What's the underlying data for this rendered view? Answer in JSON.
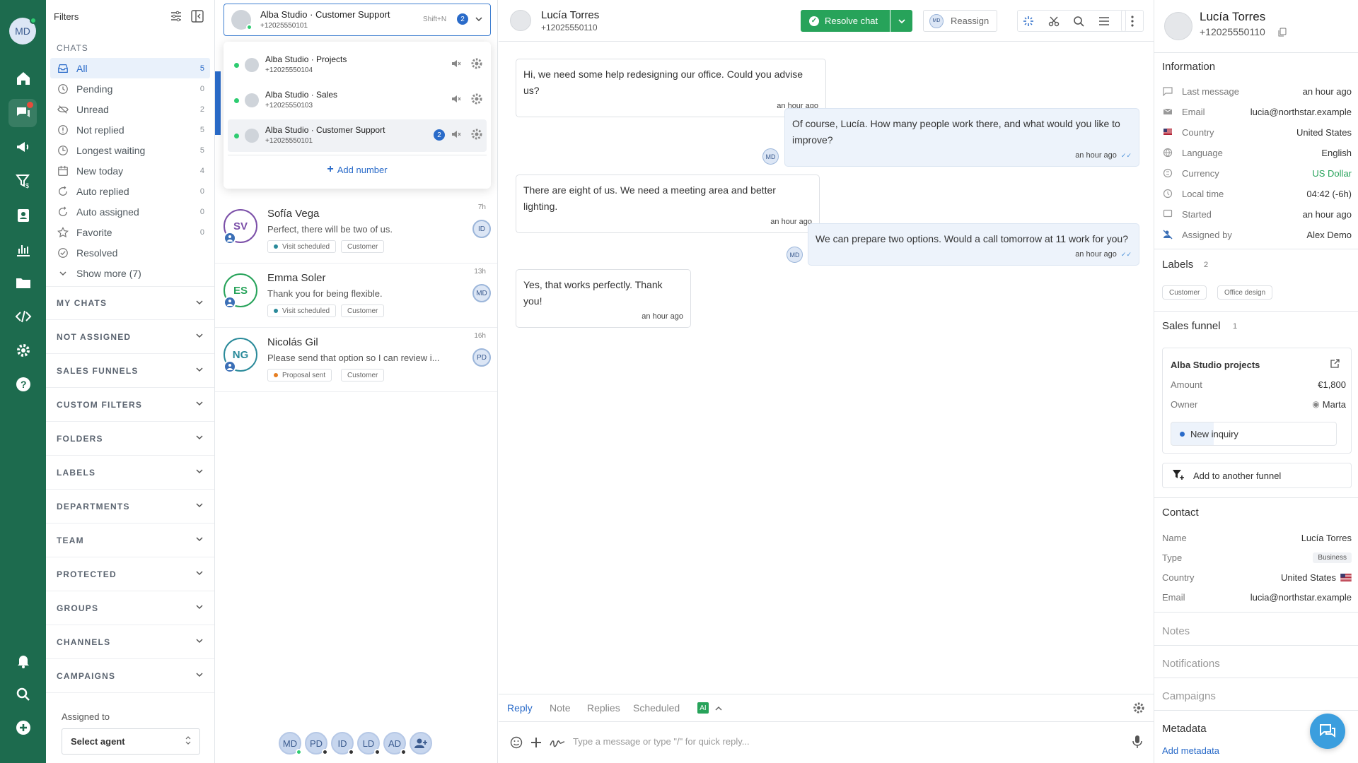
{
  "rail": {
    "avatar": "MD"
  },
  "filters": {
    "title": "Filters",
    "chats_section": "CHATS",
    "items": [
      {
        "label": "All",
        "count": "5",
        "icon": "inbox-icon"
      },
      {
        "label": "Pending",
        "count": "0",
        "icon": "clock-icon"
      },
      {
        "label": "Unread",
        "count": "2",
        "icon": "eye-off-icon"
      },
      {
        "label": "Not replied",
        "count": "5",
        "icon": "alert-circle-icon"
      },
      {
        "label": "Longest waiting",
        "count": "5",
        "icon": "hourglass-icon"
      },
      {
        "label": "New today",
        "count": "4",
        "icon": "calendar-icon"
      },
      {
        "label": "Auto replied",
        "count": "0",
        "icon": "auto-reply-icon"
      },
      {
        "label": "Auto assigned",
        "count": "0",
        "icon": "auto-assign-icon"
      },
      {
        "label": "Favorite",
        "count": "0",
        "icon": "star-icon"
      },
      {
        "label": "Resolved",
        "count": "",
        "icon": "check-circle-icon"
      }
    ],
    "show_more": "Show more (7)",
    "groups": [
      "MY CHATS",
      "NOT ASSIGNED",
      "SALES FUNNELS",
      "CUSTOM FILTERS",
      "FOLDERS",
      "LABELS",
      "DEPARTMENTS",
      "TEAM",
      "PROTECTED",
      "GROUPS",
      "CHANNELS",
      "CAMPAIGNS"
    ],
    "assigned_to_label": "Assigned to",
    "select_agent": "Select agent"
  },
  "number_selector": {
    "title": "Alba Studio · Customer Support",
    "phone": "+12025550101",
    "shortcut": "Shift+N",
    "badge": "2",
    "options": [
      {
        "title": "Alba Studio · Projects",
        "phone": "+12025550104",
        "badge": ""
      },
      {
        "title": "Alba Studio · Sales",
        "phone": "+12025550103",
        "badge": ""
      },
      {
        "title": "Alba Studio · Customer Support",
        "phone": "+12025550101",
        "badge": "2"
      }
    ],
    "add_number": "Add number"
  },
  "chats": [
    {
      "initials": "SV",
      "name": "Sofía Vega",
      "preview": "Perfect, there will be two of us.",
      "time": "7h",
      "agent": "ID",
      "tags": [
        "Visit scheduled",
        "Customer"
      ],
      "color": "#7b4fa8"
    },
    {
      "initials": "ES",
      "name": "Emma Soler",
      "preview": "Thank you for being flexible.",
      "time": "13h",
      "agent": "MD",
      "tags": [
        "Visit scheduled",
        "Customer"
      ],
      "color": "#27a35a"
    },
    {
      "initials": "NG",
      "name": "Nicolás Gil",
      "preview": "Please send that option so I can review i...",
      "time": "16h",
      "agent": "PD",
      "tags": [
        "Proposal sent",
        "Customer"
      ],
      "color": "#2a8a9a"
    }
  ],
  "agents_bar": [
    "MD",
    "PD",
    "ID",
    "LD",
    "AD"
  ],
  "conversation": {
    "name": "Lucía Torres",
    "phone": "+12025550110",
    "resolve": "Resolve chat",
    "reassign": "Reassign",
    "reassign_avatar": "MD",
    "messages": [
      {
        "dir": "in",
        "text": "Hi, we need some help redesigning our office. Could you advise us?",
        "time": "an hour ago"
      },
      {
        "dir": "out",
        "text": "Of course, Lucía. How many people work there, and what would you like to improve?",
        "time": "an hour ago",
        "agent": "MD"
      },
      {
        "dir": "in",
        "text": "There are eight of us. We need a meeting area and better lighting.",
        "time": "an hour ago"
      },
      {
        "dir": "out",
        "text": "We can prepare two options. Would a call tomorrow at 11 work for you?",
        "time": "an hour ago",
        "agent": "MD"
      },
      {
        "dir": "in",
        "text": "Yes, that works perfectly. Thank you!",
        "time": "an hour ago"
      }
    ],
    "tabs": [
      "Reply",
      "Note",
      "Replies",
      "Scheduled"
    ],
    "ai": "AI",
    "placeholder": "Type a message or type \"/\" for quick reply..."
  },
  "contact": {
    "name": "Lucía Torres",
    "phone": "+12025550110",
    "information_title": "Information",
    "info": [
      {
        "k": "Last message",
        "v": "an hour ago",
        "icon": "message-icon"
      },
      {
        "k": "Email",
        "v": "lucia@northstar.example",
        "icon": "mail-icon"
      },
      {
        "k": "Country",
        "v": "United States",
        "icon": "flag-icon"
      },
      {
        "k": "Language",
        "v": "English",
        "icon": "globe-icon"
      },
      {
        "k": "Currency",
        "v": "US Dollar",
        "icon": "currency-icon"
      },
      {
        "k": "Local time",
        "v": "04:42 (-6h)",
        "icon": "clock-icon"
      },
      {
        "k": "Started",
        "v": "an hour ago",
        "icon": "chat-icon"
      },
      {
        "k": "Assigned by",
        "v": "Alex Demo",
        "icon": "user-assign-icon"
      }
    ],
    "labels_title": "Labels",
    "labels_count": "2",
    "labels": [
      "Customer",
      "Office design"
    ],
    "funnel_title": "Sales funnel",
    "funnel_count": "1",
    "funnel": {
      "name": "Alba Studio projects",
      "amount_k": "Amount",
      "amount": "€1,800",
      "owner_k": "Owner",
      "owner": "Marta",
      "stage": "New inquiry"
    },
    "add_funnel": "Add to another funnel",
    "contact_title": "Contact",
    "contact_rows": [
      {
        "k": "Name",
        "v": "Lucía Torres"
      },
      {
        "k": "Type",
        "v": "Business"
      },
      {
        "k": "Country",
        "v": "United States"
      },
      {
        "k": "Email",
        "v": "lucia@northstar.example"
      }
    ],
    "notes": "Notes",
    "notifications": "Notifications",
    "campaigns": "Campaigns",
    "metadata": "Metadata",
    "add_metadata": "Add metadata"
  },
  "colors": {
    "rail": "#1d6b4e",
    "accent": "#2a6bc9",
    "resolve": "#27a35a"
  }
}
